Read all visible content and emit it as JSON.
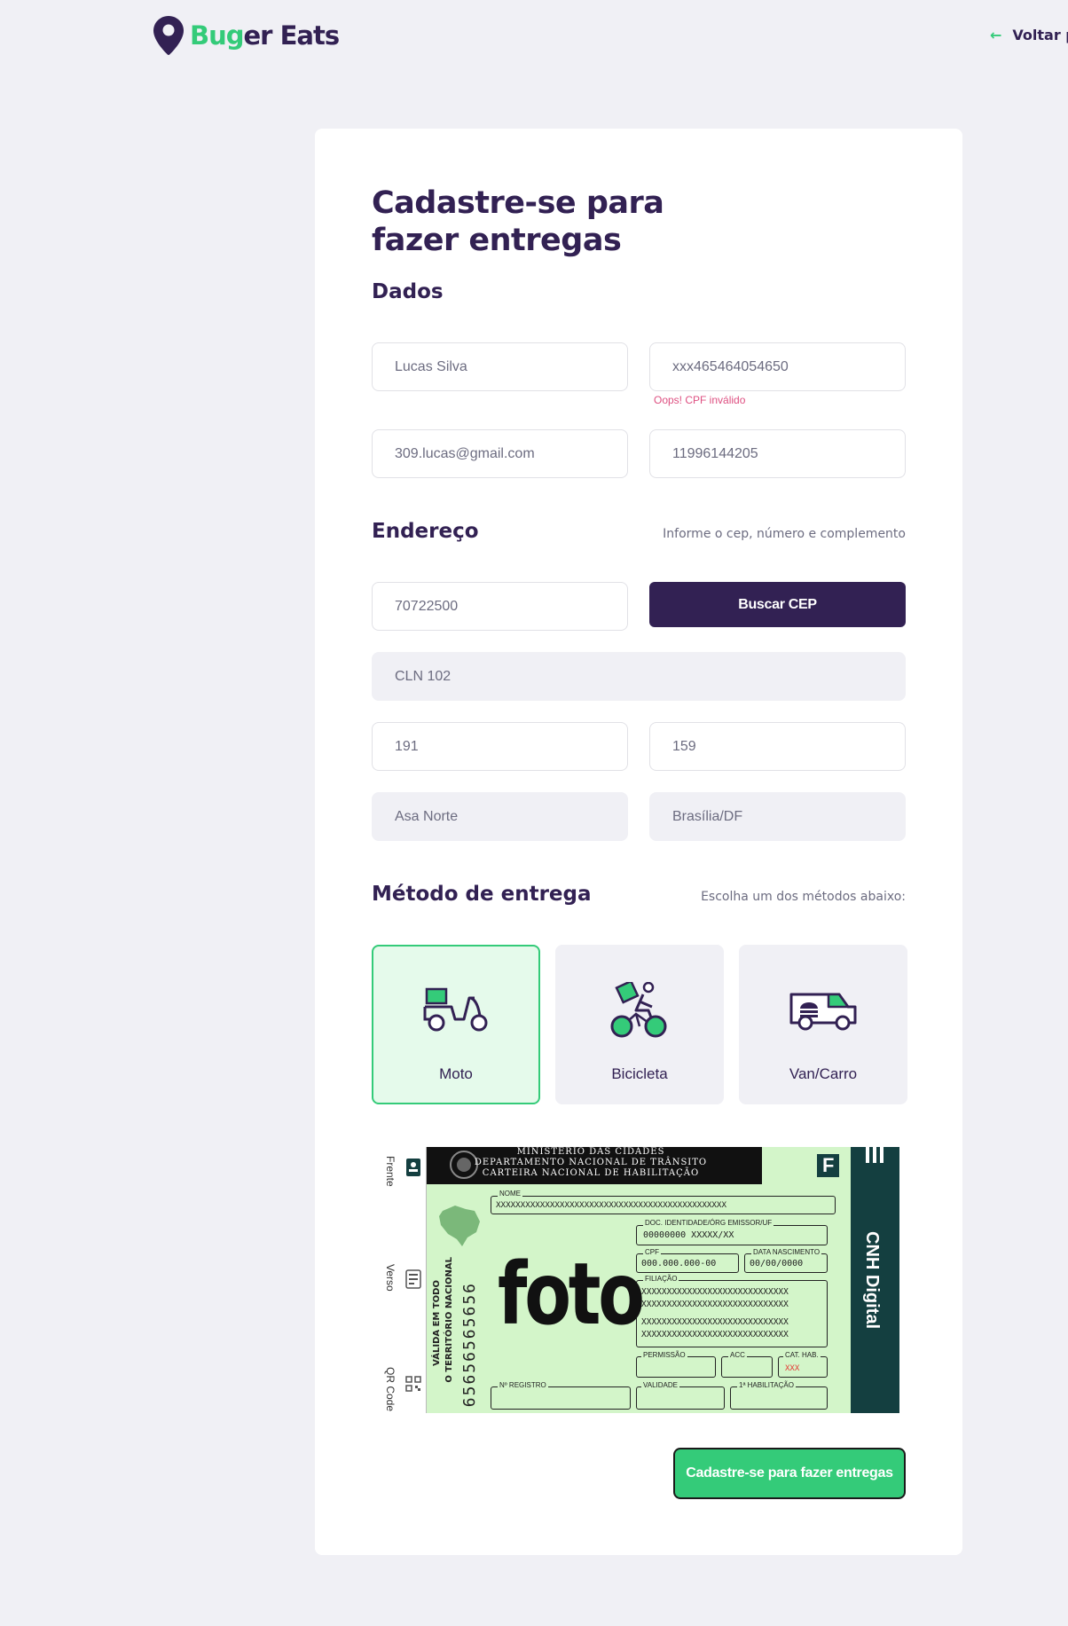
{
  "header": {
    "logo_part1": "Bug",
    "logo_part2": "er Eats",
    "back_label": "Voltar p"
  },
  "form": {
    "title_line1": "Cadastre-se para",
    "title_line2": "fazer entregas",
    "dados": {
      "section_title": "Dados",
      "name": "Lucas Silva",
      "cpf": "xxx465464054650",
      "cpf_error": "Oops! CPF inválido",
      "email": "309.lucas@gmail.com",
      "whatsapp": "11996144205"
    },
    "endereco": {
      "section_title": "Endereço",
      "hint": "Informe o cep, número e complemento",
      "cep": "70722500",
      "buscar_cep_label": "Buscar CEP",
      "rua": "CLN 102",
      "numero": "191",
      "complemento": "159",
      "bairro": "Asa Norte",
      "cidade_uf": "Brasília/DF"
    },
    "metodo": {
      "section_title": "Método de entrega",
      "hint": "Escolha um dos métodos abaixo:",
      "options": [
        {
          "label": "Moto",
          "icon": "scooter-icon",
          "selected": true
        },
        {
          "label": "Bicicleta",
          "icon": "bicycle-icon",
          "selected": false
        },
        {
          "label": "Van/Carro",
          "icon": "van-icon",
          "selected": false
        }
      ]
    },
    "cnh": {
      "tab_front": "Frente",
      "tab_back": "Verso",
      "tab_qr": "QR Code",
      "header_line1": "MINISTÉRIO DAS CIDADES",
      "header_line2": "DEPARTAMENTO NACIONAL DE TRÂNSITO",
      "header_line3": "CARTEIRA NACIONAL DE HABILITAÇÃO",
      "nome_label": "NOME",
      "nome_value": "XXXXXXXXXXXXXXXXXXXXXXXXXXXXXXXXXXXXXXXXXXXXXXX",
      "doc_label": "DOC. IDENTIDADE/ÓRG EMISSOR/UF",
      "doc_value": "00000000 XXXXX/XX",
      "cpf_label": "CPF",
      "cpf_value": "000.000.000-00",
      "nasc_label": "DATA NASCIMENTO",
      "nasc_value": "00/00/0000",
      "filiacao_label": "FILIAÇÃO",
      "filiacao_line": "XXXXXXXXXXXXXXXXXXXXXXXXXXXXX",
      "permissao_label": "PERMISSÃO",
      "acc_label": "ACC",
      "cat_label": "CAT. HAB.",
      "cat_value": "XXX",
      "registro_label": "Nº REGISTRO",
      "validade_label": "VALIDADE",
      "primeira_hab_label": "1ª HABILITAÇÃO",
      "valida_line1": "VÁLIDA EM TODO",
      "valida_line2": "O TERRITÓRIO NACIONAL",
      "side_number": "65656565656",
      "foto_text": "foto",
      "digital_label": "CNH Digital",
      "corner_letter": "F"
    },
    "submit_label": "Cadastre-se para fazer entregas"
  },
  "colors": {
    "primary": "#322153",
    "accent": "#34cb79",
    "error": "#de4f81",
    "background": "#f0f0f5"
  }
}
